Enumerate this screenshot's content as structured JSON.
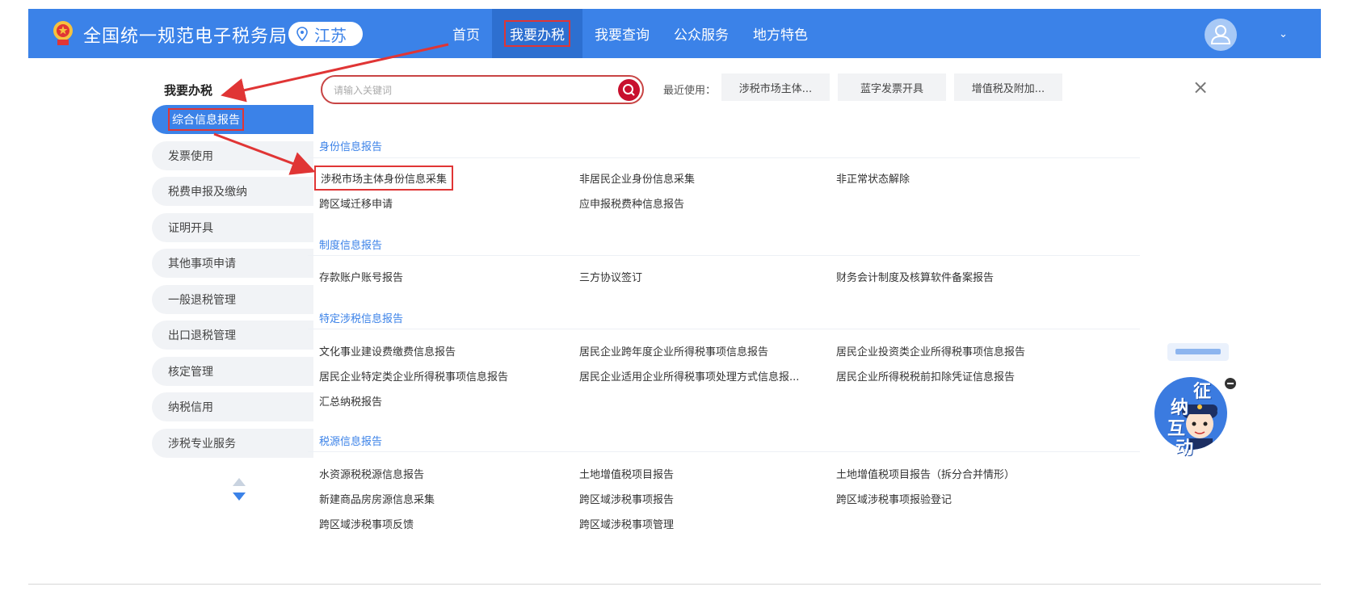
{
  "header": {
    "title": "全国统一规范电子税务局",
    "region": "江苏",
    "nav": [
      {
        "label": "首页",
        "active": false
      },
      {
        "label": "我要办税",
        "active": true
      },
      {
        "label": "我要查询",
        "active": false
      },
      {
        "label": "公众服务",
        "active": false
      },
      {
        "label": "地方特色",
        "active": false
      }
    ],
    "chevron": "⌄"
  },
  "sidebar": {
    "title": "我要办税",
    "items": [
      {
        "label": "综合信息报告",
        "active": true
      },
      {
        "label": "发票使用"
      },
      {
        "label": "税费申报及缴纳"
      },
      {
        "label": "证明开具"
      },
      {
        "label": "其他事项申请"
      },
      {
        "label": "一般退税管理"
      },
      {
        "label": "出口退税管理"
      },
      {
        "label": "核定管理"
      },
      {
        "label": "纳税信用"
      },
      {
        "label": "涉税专业服务"
      }
    ]
  },
  "search": {
    "placeholder": "请输入关键词"
  },
  "recent": {
    "label": "最近使用：",
    "chips": [
      "涉税市场主体...",
      "蓝字发票开具",
      "增值税及附加..."
    ]
  },
  "close_label": "×",
  "groups": [
    {
      "title": "身份信息报告",
      "items": [
        "涉税市场主体身份信息采集",
        "非居民企业身份信息采集",
        "非正常状态解除",
        "跨区域迁移申请",
        "应申报税费种信息报告"
      ]
    },
    {
      "title": "制度信息报告",
      "items": [
        "存款账户账号报告",
        "三方协议签订",
        "财务会计制度及核算软件备案报告"
      ]
    },
    {
      "title": "特定涉税信息报告",
      "items": [
        "文化事业建设费缴费信息报告",
        "居民企业跨年度企业所得税事项信息报告",
        "居民企业投资类企业所得税事项信息报告",
        "居民企业特定类企业所得税事项信息报告",
        "居民企业适用企业所得税事项处理方式信息报...",
        "居民企业所得税税前扣除凭证信息报告",
        "汇总纳税报告"
      ]
    },
    {
      "title": "税源信息报告",
      "items": [
        "水资源税税源信息报告",
        "土地增值税项目报告",
        "土地增值税项目报告（拆分合并情形）",
        "新建商品房房源信息采集",
        "跨区域涉税事项报告",
        "跨区域涉税事项报验登记",
        "跨区域涉税事项反馈",
        "跨区域涉税事项管理"
      ]
    }
  ],
  "chat": {
    "chars": [
      "征",
      "纳",
      "互",
      "动"
    ]
  },
  "colors": {
    "primary": "#3b82e8",
    "highlight_box": "#e03535",
    "search_button": "#c8102e"
  }
}
